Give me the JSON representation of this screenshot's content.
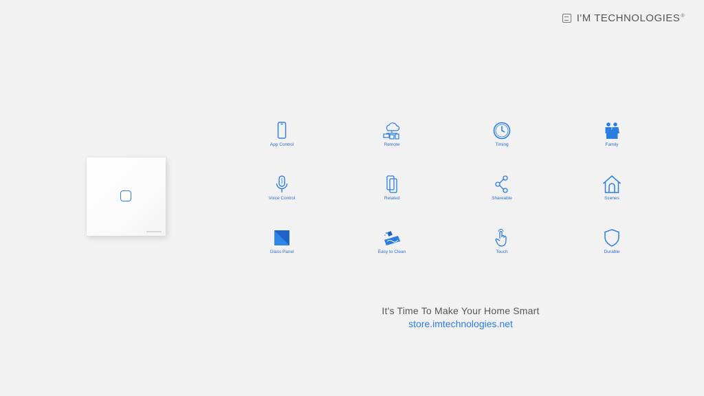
{
  "brand": {
    "name": "I'M TECHNOLOGIES",
    "reg": "®",
    "logo_icon": "im-logo-icon"
  },
  "accent_color": "#2a7de1",
  "features": [
    {
      "label": "App Control",
      "icon": "smartphone-icon"
    },
    {
      "label": "Remote",
      "icon": "cloud-network-icon"
    },
    {
      "label": "Timing",
      "icon": "clock-icon"
    },
    {
      "label": "Family",
      "icon": "family-icon"
    },
    {
      "label": "Voice Control",
      "icon": "microphone-icon"
    },
    {
      "label": "Related",
      "icon": "linked-phones-icon"
    },
    {
      "label": "Shareable",
      "icon": "share-icon"
    },
    {
      "label": "Scenes",
      "icon": "home-icon"
    },
    {
      "label": "Glass Panel",
      "icon": "glass-panel-icon"
    },
    {
      "label": "Easy to Clean",
      "icon": "cleaning-icon"
    },
    {
      "label": "Touch",
      "icon": "touch-hand-icon"
    },
    {
      "label": "Durable",
      "icon": "shield-icon"
    }
  ],
  "tagline": "It's Time To Make Your Home Smart",
  "store_link": "store.imtechnologies.net"
}
